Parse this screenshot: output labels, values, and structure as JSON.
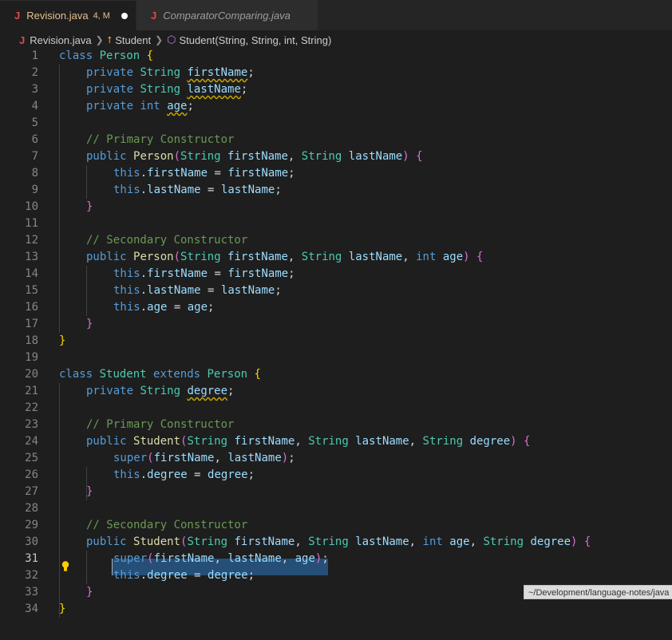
{
  "tabs": [
    {
      "icon": "J",
      "label": "Revision.java",
      "badge": "4, M",
      "modified": true
    },
    {
      "icon": "J",
      "label": "ComparatorComparing.java"
    }
  ],
  "breadcrumb": {
    "file": "Revision.java",
    "class": "Student",
    "method": "Student(String, String, int, String)"
  },
  "editor": {
    "active_line": 31,
    "line_numbers": [
      "1",
      "2",
      "3",
      "4",
      "5",
      "6",
      "7",
      "8",
      "9",
      "10",
      "11",
      "12",
      "13",
      "14",
      "15",
      "16",
      "17",
      "18",
      "19",
      "20",
      "21",
      "22",
      "23",
      "24",
      "25",
      "26",
      "27",
      "28",
      "29",
      "30",
      "31",
      "32",
      "33",
      "34"
    ],
    "code": {
      "l1": [
        "class",
        "Person",
        "{"
      ],
      "l2": [
        "private",
        "String",
        "firstName",
        ";"
      ],
      "l3": [
        "private",
        "String",
        "lastName",
        ";"
      ],
      "l4": [
        "private",
        "int",
        "age",
        ";"
      ],
      "l6": "// Primary Constructor",
      "l7": [
        "public",
        "Person",
        "(",
        "String",
        "firstName",
        ",",
        "String",
        "lastName",
        ")",
        "{"
      ],
      "l8": [
        "this",
        ".",
        "firstName",
        " = ",
        "firstName",
        ";"
      ],
      "l9": [
        "this",
        ".",
        "lastName",
        " = ",
        "lastName",
        ";"
      ],
      "l10": "}",
      "l12": "// Secondary Constructor",
      "l13": [
        "public",
        "Person",
        "(",
        "String",
        "firstName",
        ",",
        "String",
        "lastName",
        ",",
        "int",
        "age",
        ")",
        "{"
      ],
      "l14": [
        "this",
        ".",
        "firstName",
        " = ",
        "firstName",
        ";"
      ],
      "l15": [
        "this",
        ".",
        "lastName",
        " = ",
        "lastName",
        ";"
      ],
      "l16": [
        "this",
        ".",
        "age",
        " = ",
        "age",
        ";"
      ],
      "l17": "}",
      "l18": "}",
      "l20": [
        "class",
        "Student",
        "extends",
        "Person",
        "{"
      ],
      "l21": [
        "private",
        "String",
        "degree",
        ";"
      ],
      "l23": "// Primary Constructor",
      "l24": [
        "public",
        "Student",
        "(",
        "String",
        "firstName",
        ",",
        "String",
        "lastName",
        ",",
        "String",
        "degree",
        ")",
        "{"
      ],
      "l25": [
        "super",
        "(",
        "firstName",
        ", ",
        "lastName",
        ")",
        ";"
      ],
      "l26": [
        "this",
        ".",
        "degree",
        " = ",
        "degree",
        ";"
      ],
      "l27": "}",
      "l29": "// Secondary Constructor",
      "l30": [
        "public",
        "Student",
        "(",
        "String",
        "firstName",
        ",",
        "String",
        "lastName",
        ",",
        "int",
        "age",
        ",",
        "String",
        "degree",
        ")",
        "{"
      ],
      "l31": [
        "super",
        "(",
        "firstName",
        ", ",
        "lastName",
        ", ",
        "age",
        ")",
        ";"
      ],
      "l32": [
        "this",
        ".",
        "degree",
        " = ",
        "degree",
        ";"
      ],
      "l33": "}",
      "l34": "}"
    }
  },
  "tooltip": "~/Development/language-notes/java",
  "colors": {
    "background": "#1e1e1e",
    "keyword": "#569cd6",
    "type": "#4ec9b0",
    "variable": "#9cdcfe",
    "comment": "#6a9955",
    "function": "#dcdcaa",
    "bracket_level1": "#ffd700",
    "bracket_level2": "#da70d6",
    "selection": "#264f78",
    "modified_tab": "#e2c08d",
    "java_icon": "#e04a4a"
  }
}
